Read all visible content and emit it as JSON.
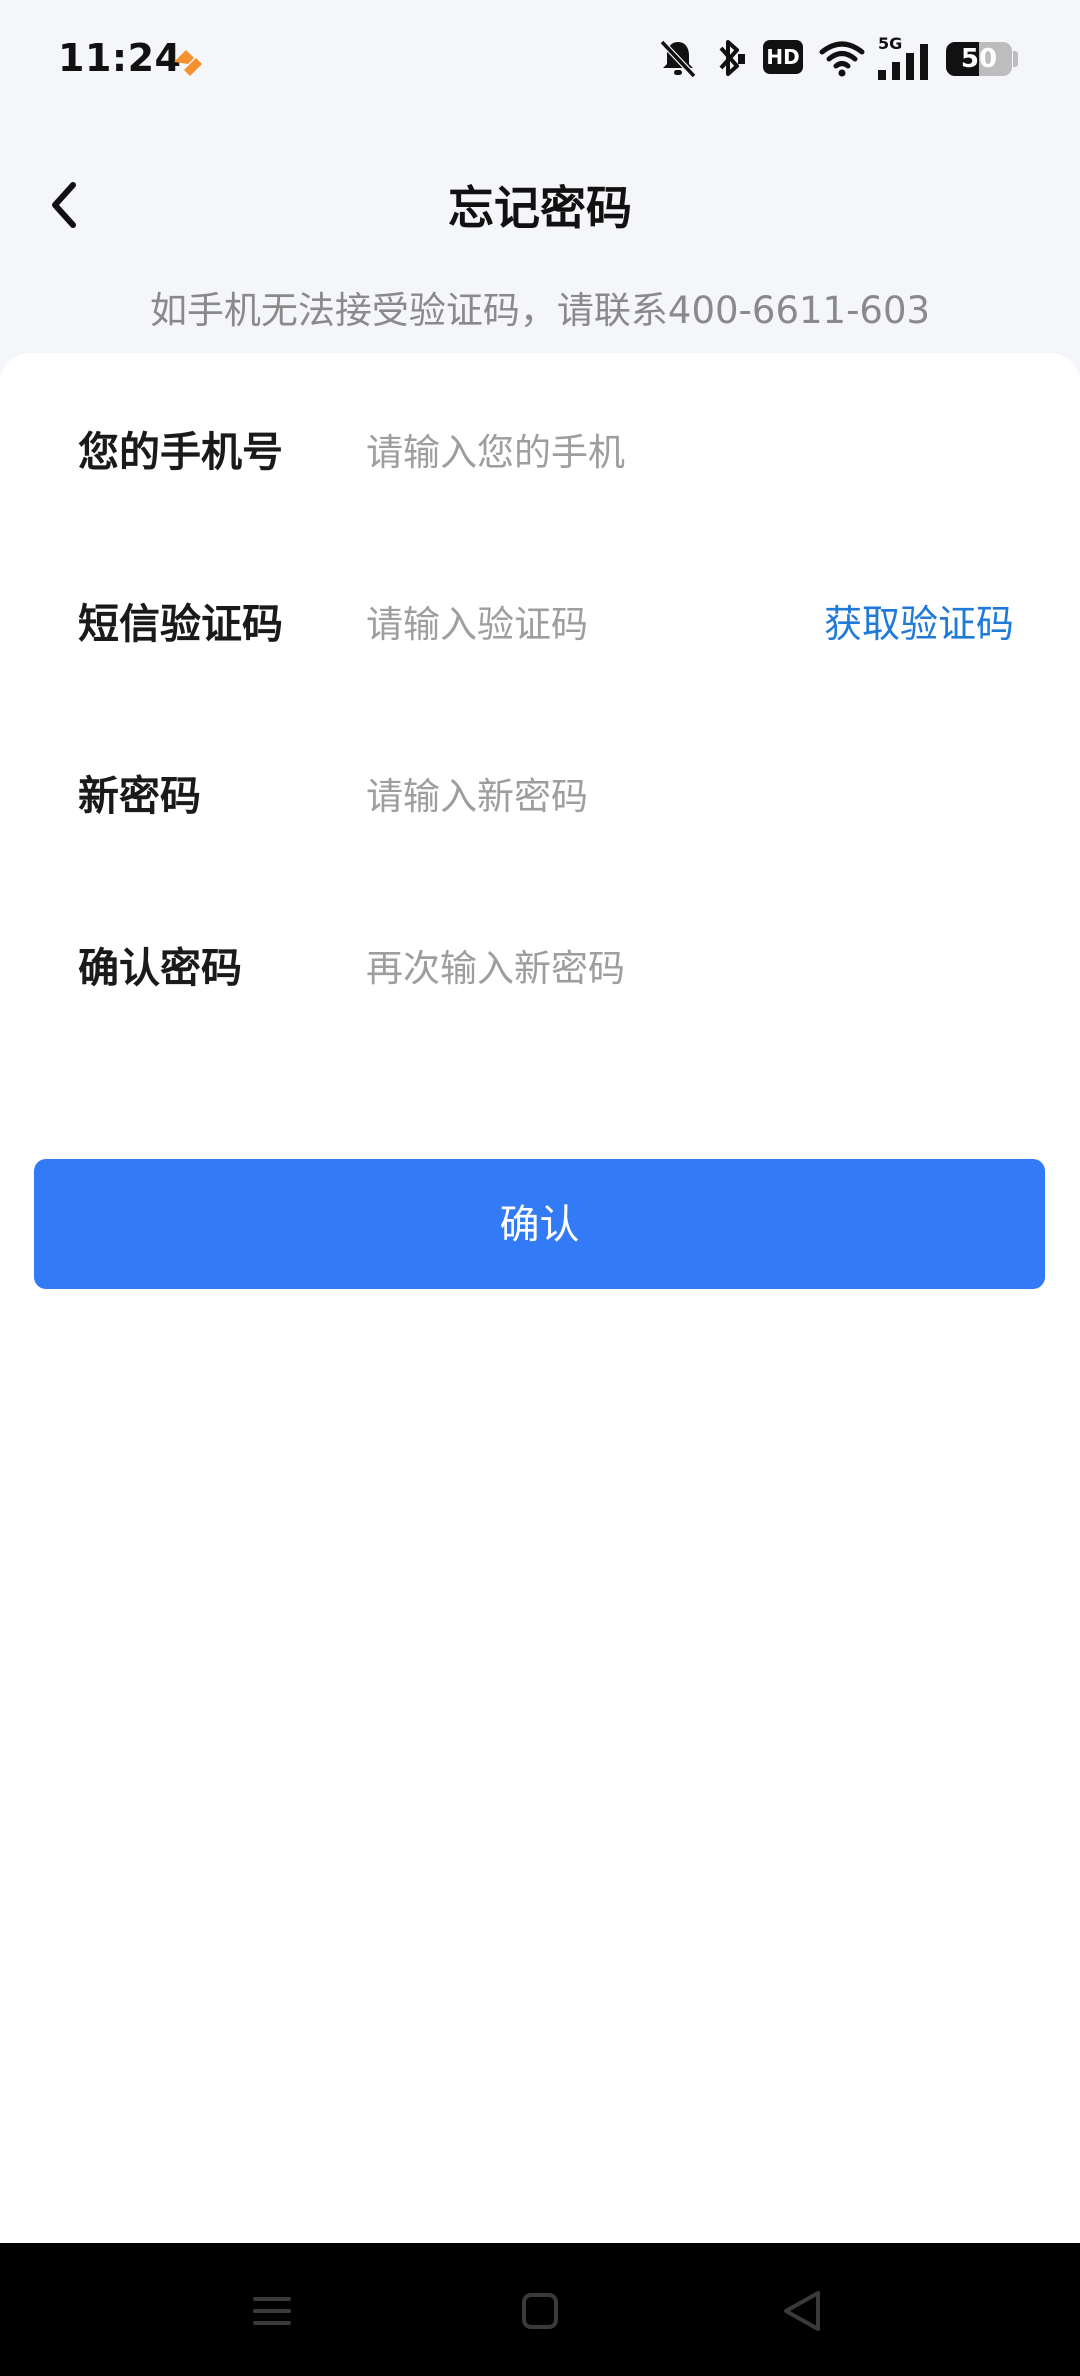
{
  "status_bar": {
    "time": "11:24",
    "battery_level": "50",
    "battery_fraction": 0.5,
    "network": "5G",
    "hd_badge": "HD",
    "icons": [
      "mute-bell-icon",
      "bluetooth-icon",
      "hd-icon",
      "wifi-icon",
      "signal-5g-icon",
      "battery-icon"
    ]
  },
  "header": {
    "title": "忘记密码",
    "back_icon": "chevron-left-icon"
  },
  "notice": "如手机无法接受验证码，请联系400-6611-603",
  "form": {
    "phone": {
      "label": "您的手机号",
      "placeholder": "请输入您的手机",
      "value": ""
    },
    "sms_code": {
      "label": "短信验证码",
      "placeholder": "请输入验证码",
      "value": "",
      "get_code_label": "获取验证码"
    },
    "new_password": {
      "label": "新密码",
      "placeholder": "请输入新密码",
      "value": ""
    },
    "confirm_password": {
      "label": "确认密码",
      "placeholder": "再次输入新密码",
      "value": ""
    }
  },
  "confirm_button": "确认",
  "nav_bar": {
    "icons": [
      "menu-icon",
      "home-icon",
      "back-triangle-icon"
    ]
  },
  "colors": {
    "accent": "#337bf6",
    "link": "#1f7ad8",
    "background": "#f5f6fa",
    "card": "#ffffff",
    "app_icon": "#f5922f"
  }
}
